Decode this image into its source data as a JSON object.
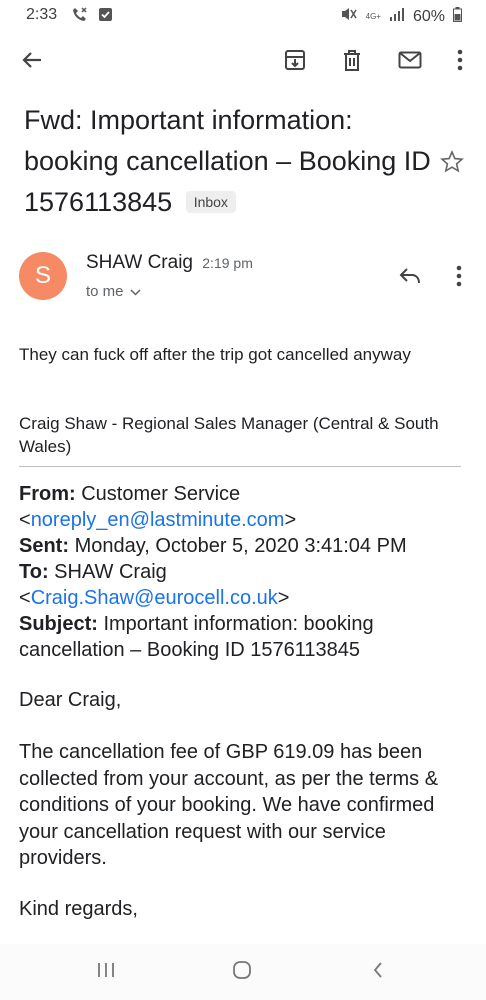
{
  "status": {
    "time": "2:33",
    "battery": "60%",
    "network": "4G+"
  },
  "toolbar": {
    "back_icon": "arrow-back-icon",
    "archive_icon": "archive-icon",
    "delete_icon": "trash-icon",
    "mark_unread_icon": "mail-icon",
    "more_icon": "more-vert-icon"
  },
  "email": {
    "subject": "Fwd: Important information: booking cancellation – Booking ID 1576113845",
    "label": "Inbox",
    "sender_initial": "S",
    "sender_name": "SHAW Craig",
    "time": "2:19 pm",
    "recipient": "to me",
    "body_line1": "They can fuck off after the trip got cancelled anyway",
    "signature": "Craig Shaw - Regional Sales Manager (Central & South Wales)"
  },
  "forwarded": {
    "from_label": "From:",
    "from_name": "Customer Service",
    "from_email": "noreply_en@lastminute.com",
    "sent_label": "Sent:",
    "sent_value": "Monday, October 5, 2020 3:41:04 PM",
    "to_label": "To:",
    "to_name": "SHAW Craig",
    "to_email": "Craig.Shaw@eurocell.co.uk",
    "subject_label": "Subject:",
    "subject_value": "Important information: booking cancellation – Booking ID 1576113845",
    "greeting": "Dear Craig,",
    "paragraph": "The cancellation fee of GBP 619.09 has been collected from your account, as per the terms & conditions of your booking. We have confirmed your cancellation request with our service providers.",
    "closing": "Kind regards,"
  }
}
